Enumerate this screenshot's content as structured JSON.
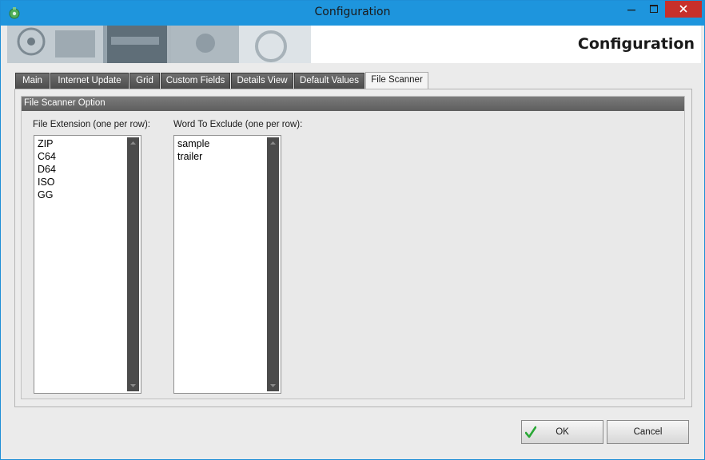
{
  "window": {
    "title": "Configuration",
    "controls": {
      "minimize": "minimize",
      "maximize": "maximize",
      "close": "close"
    }
  },
  "banner": {
    "title": "Configuration"
  },
  "tabs": [
    {
      "label": "Main",
      "active": false
    },
    {
      "label": "Internet Update",
      "active": false
    },
    {
      "label": "Grid",
      "active": false
    },
    {
      "label": "Custom Fields",
      "active": false
    },
    {
      "label": "Details View",
      "active": false
    },
    {
      "label": "Default Values",
      "active": false
    },
    {
      "label": "File Scanner",
      "active": true
    }
  ],
  "group": {
    "header": "File Scanner Option",
    "extensions": {
      "label": "File Extension (one per row):",
      "items": [
        "ZIP",
        "C64",
        "D64",
        "ISO",
        "GG"
      ]
    },
    "exclude": {
      "label": "Word To Exclude (one per row):",
      "items": [
        "sample",
        "trailer"
      ]
    }
  },
  "buttons": {
    "ok": "OK",
    "cancel": "Cancel"
  },
  "colors": {
    "titlebar": "#1e95dd",
    "close_button": "#c7302b",
    "tab_inactive": "#5a5a5a",
    "ok_check": "#2aa836"
  }
}
